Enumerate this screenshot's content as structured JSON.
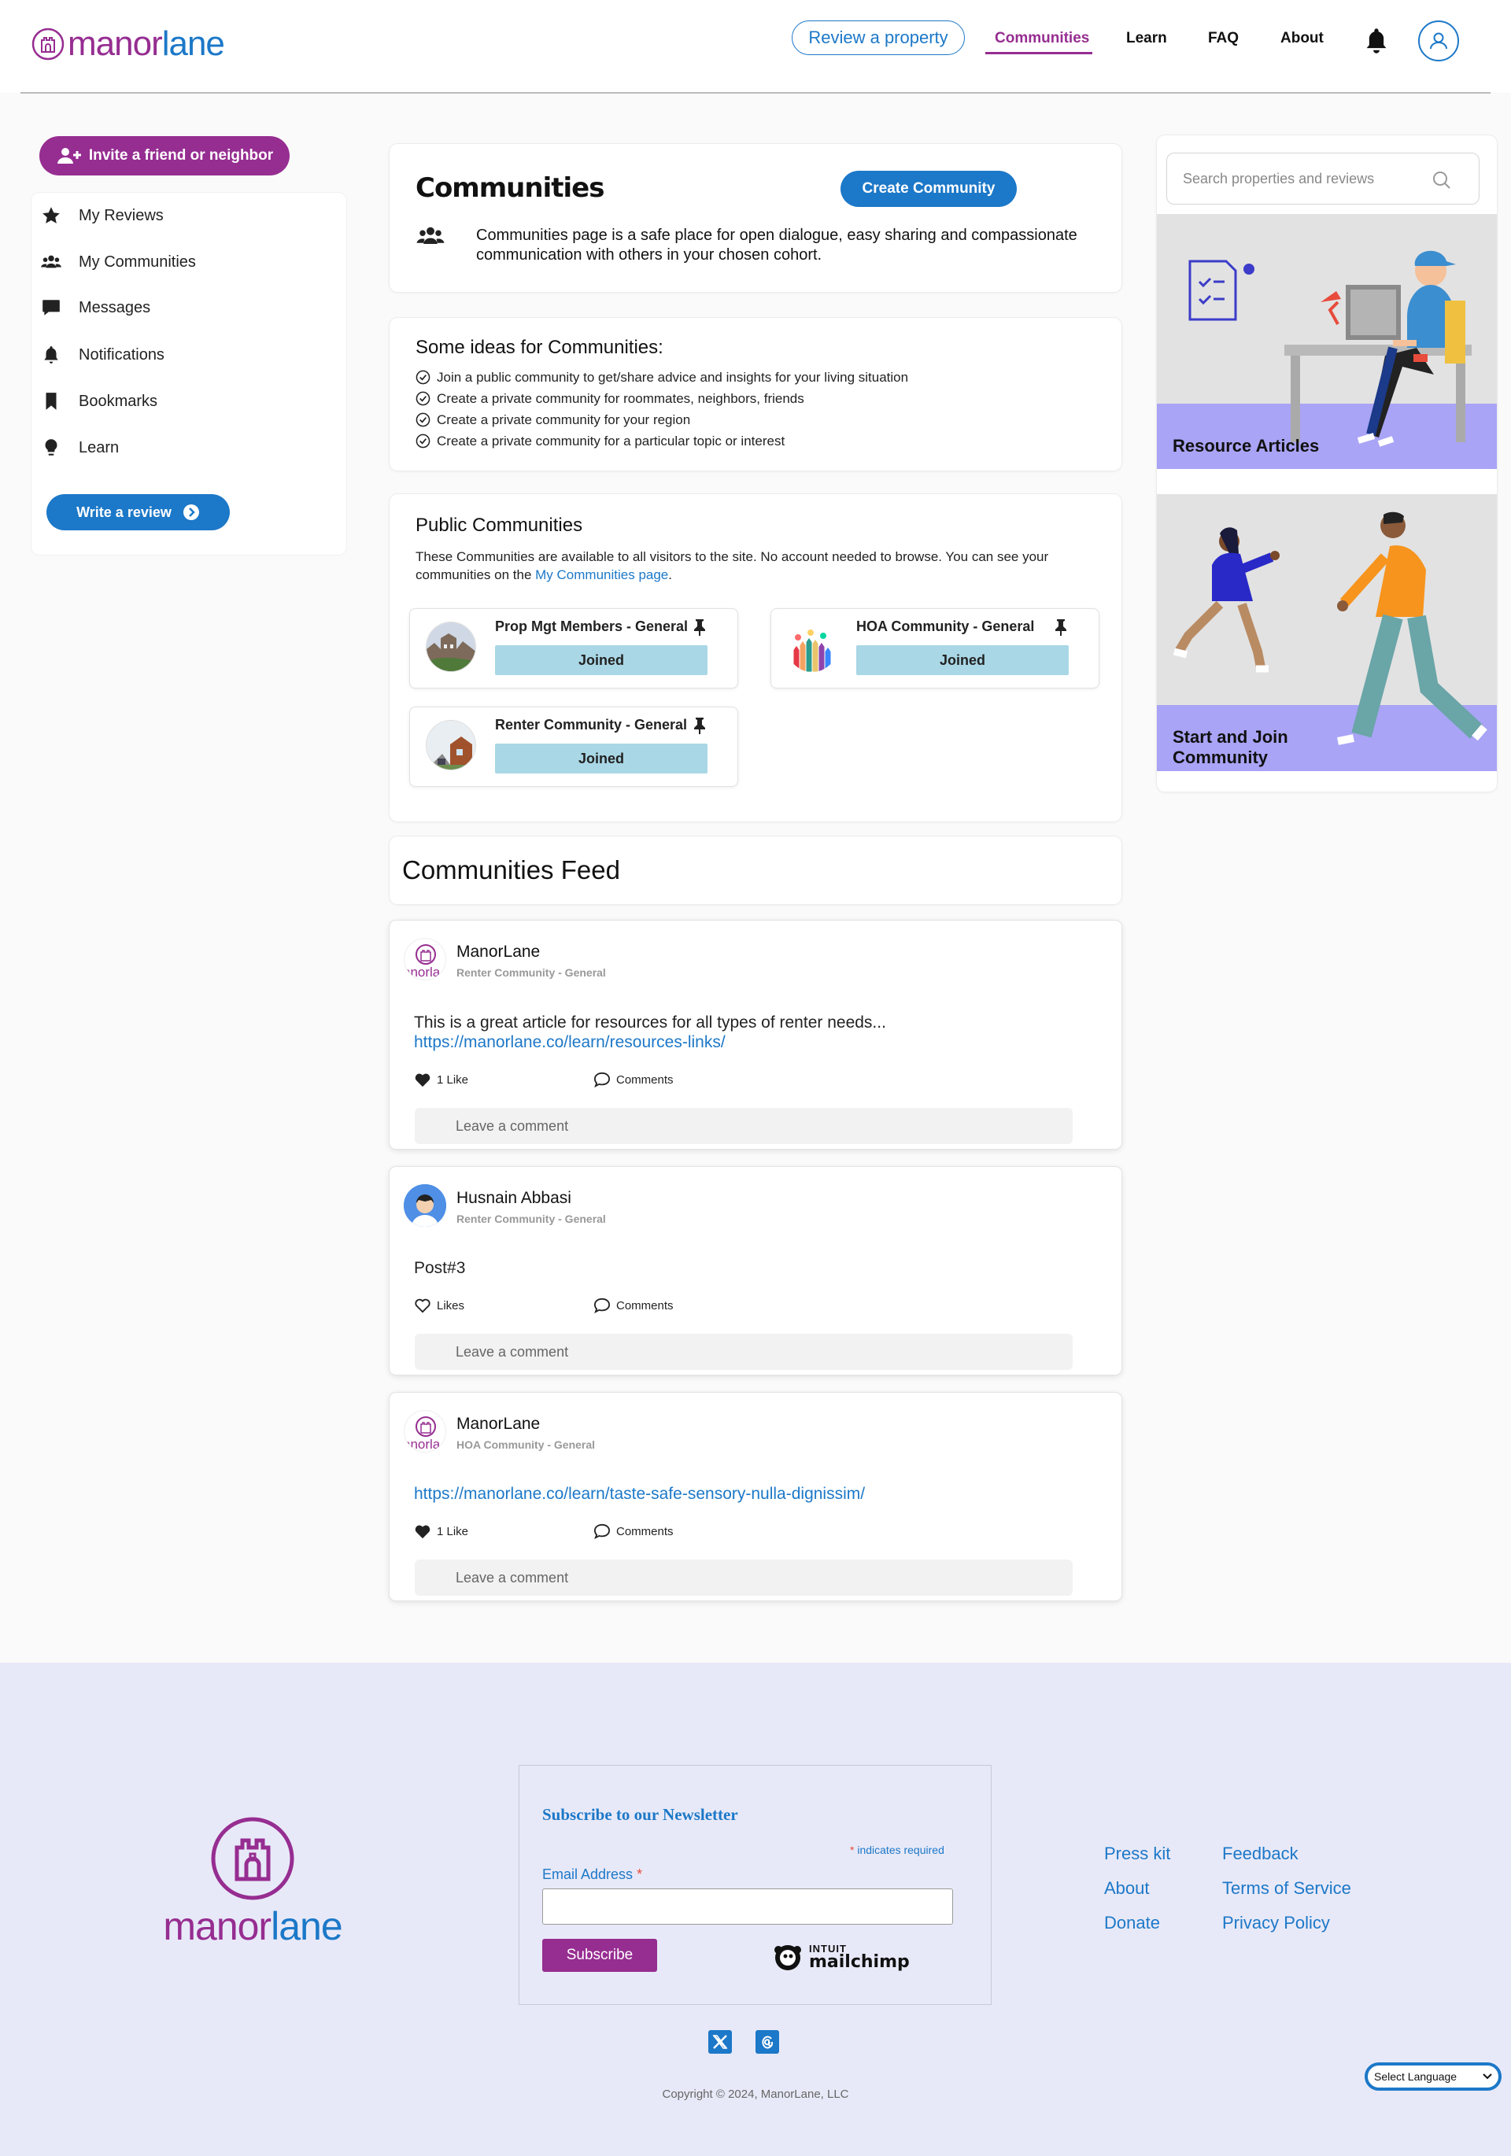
{
  "header": {
    "logo": {
      "part1": "manor",
      "part2": "lane"
    },
    "review_button": "Review a property",
    "nav": {
      "communities": "Communities",
      "learn": "Learn",
      "faq": "FAQ",
      "about": "About"
    }
  },
  "sidebar": {
    "invite_button": "Invite a friend or neighbor",
    "items": [
      {
        "label": "My Reviews",
        "icon": "star-icon"
      },
      {
        "label": "My Communities",
        "icon": "users-icon"
      },
      {
        "label": "Messages",
        "icon": "message-icon"
      },
      {
        "label": "Notifications",
        "icon": "bell-icon"
      },
      {
        "label": "Bookmarks",
        "icon": "bookmark-icon"
      },
      {
        "label": "Learn",
        "icon": "lightbulb-icon"
      }
    ],
    "write_review_button": "Write a review"
  },
  "communities_header": {
    "title": "Communities",
    "create_button": "Create Community",
    "description": "Communities page is a safe place for open dialogue, easy sharing and compassionate communication with others in your chosen cohort."
  },
  "ideas": {
    "title": "Some ideas for Communities:",
    "items": [
      "Join a public community to get/share advice and insights for your living situation",
      "Create a private community for roommates, neighbors, friends",
      "Create a private community for your region",
      "Create a private community for a particular topic or interest"
    ]
  },
  "public": {
    "title": "Public Communities",
    "desc_before": "These Communities are available to all visitors to the site. No account needed to browse. You can see your communities on the ",
    "desc_link": "My Communities page",
    "desc_after": ".",
    "communities": [
      {
        "name": "Prop Mgt Members - General",
        "status": "Joined"
      },
      {
        "name": "HOA Community - General",
        "status": "Joined"
      },
      {
        "name": "Renter Community - General",
        "status": "Joined"
      }
    ]
  },
  "feed": {
    "title": "Communities Feed",
    "comment_placeholder": "Leave a comment",
    "posts": [
      {
        "author": "ManorLane",
        "community": "Renter Community - General",
        "text": "This is a great article for resources for all types of renter needs...",
        "link": "https://manorlane.co/learn/resources-links/",
        "likes": "1 Like",
        "comments": "Comments"
      },
      {
        "author": "Husnain Abbasi",
        "community": "Renter Community - General",
        "text": "Post#3",
        "likes": "Likes",
        "comments": "Comments"
      },
      {
        "author": "ManorLane",
        "community": "HOA Community - General",
        "link": "https://manorlane.co/learn/taste-safe-sensory-nulla-dignissim/",
        "likes": "1 Like",
        "comments": "Comments"
      }
    ]
  },
  "right": {
    "search_placeholder": "Search properties and reviews",
    "resources_label": "Resource Articles",
    "start_join_label_1": "Start and Join",
    "start_join_label_2": "Community"
  },
  "footer": {
    "newsletter_title": "Subscribe to our Newsletter",
    "required_note": "indicates required",
    "email_label": "Email Address",
    "subscribe_button": "Subscribe",
    "mailchimp_1": "INTUIT",
    "mailchimp_2": "mailchimp",
    "links": [
      "Press kit",
      "Feedback",
      "About",
      "Terms of Service",
      "Donate",
      "Privacy Policy"
    ],
    "copyright": "Copyright © 2024, ManorLane, LLC",
    "language": "Select Language"
  },
  "colors": {
    "brand_purple": "#962d91",
    "brand_blue": "#1c78c8",
    "footer_bg": "#e8e9f8",
    "joined_bg": "#a9d7e6",
    "illustration_bg": "#a9a4f6"
  }
}
